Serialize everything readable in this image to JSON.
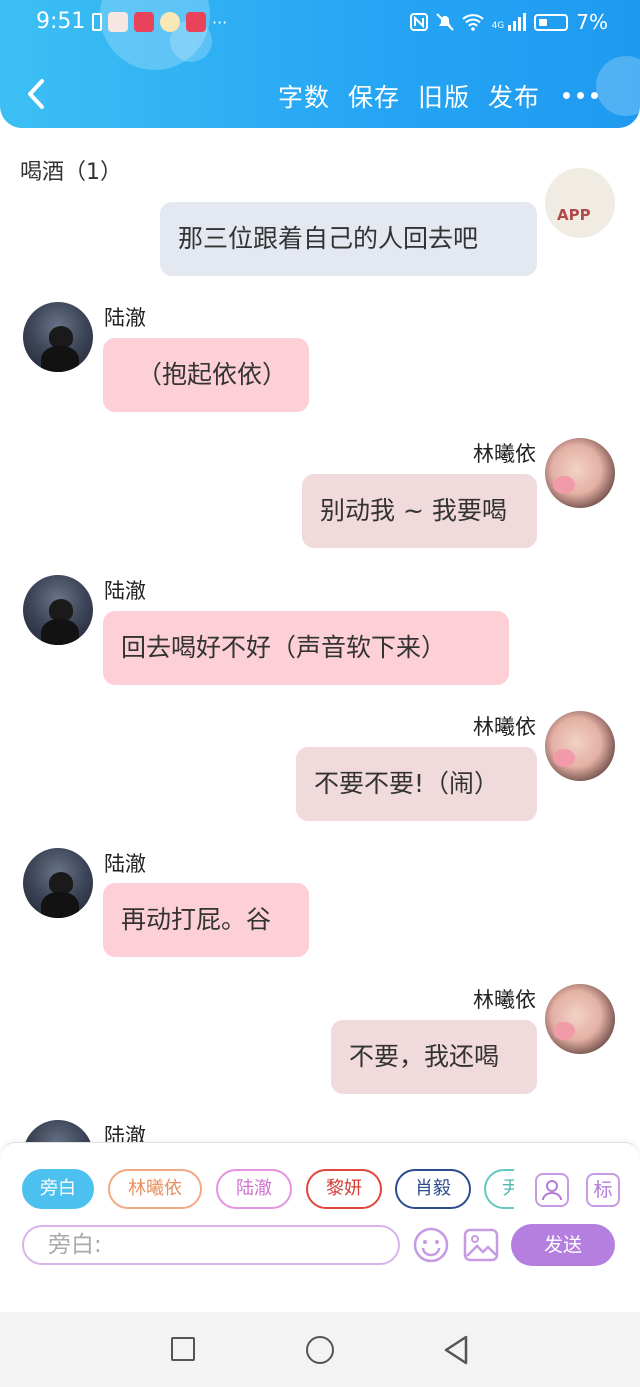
{
  "status_bar": {
    "time": "9:51",
    "more": "···",
    "battery": "7%",
    "network": "4G"
  },
  "header": {
    "actions": [
      "字数",
      "保存",
      "旧版",
      "发布"
    ]
  },
  "chapter_title": "喝酒（1）",
  "partial_avatar_text": "APP",
  "messages": [
    {
      "speaker": "",
      "text": "那三位跟着自己的人回去吧"
    },
    {
      "speaker": "陆澈",
      "text": "（抱起依依）"
    },
    {
      "speaker": "林曦依",
      "text": "别动我 ~ 我要喝"
    },
    {
      "speaker": "陆澈",
      "text": "回去喝好不好（声音软下来）"
    },
    {
      "speaker": "林曦依",
      "text": "不要不要!（闹）"
    },
    {
      "speaker": "陆澈",
      "text": "再动打屁。谷"
    },
    {
      "speaker": "林曦依",
      "text": "不要，我还喝"
    },
    {
      "speaker": "陆澈",
      "text": ""
    }
  ],
  "input_panel": {
    "chips": [
      "旁白",
      "林曦依",
      "陆澈",
      "黎妍",
      "肖毅",
      "尹"
    ],
    "chip_colors": [
      "#4cc0ee",
      "#f0a980",
      "#e493e0",
      "#e0463e",
      "#2c4c8c",
      "#62c8c0"
    ],
    "tag_label": "标",
    "placeholder": "旁白:",
    "send_label": "发送"
  }
}
